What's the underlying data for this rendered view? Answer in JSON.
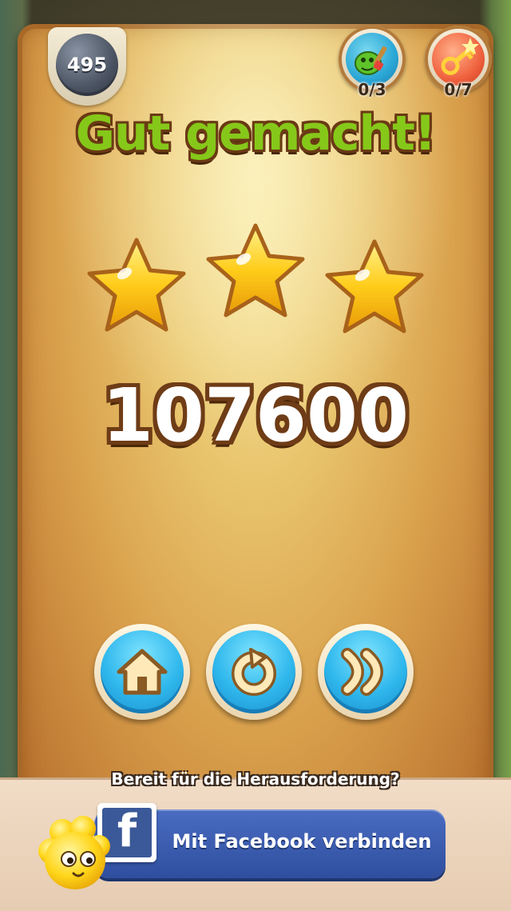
{
  "level": {
    "number": "495"
  },
  "counters": [
    {
      "icon": "jelly-paint-icon",
      "value": "0/3"
    },
    {
      "icon": "golden-key-icon",
      "value": "0/7"
    }
  ],
  "result": {
    "title": "Gut gemacht!",
    "stars_earned": 3,
    "stars_total": 3,
    "score": "107600"
  },
  "actions": {
    "home_icon": "home-icon",
    "retry_icon": "retry-icon",
    "next_icon": "next-icon"
  },
  "footer": {
    "prompt": "Bereit für die Herausforderung?",
    "facebook_button_label": "Mit Facebook verbinden",
    "facebook_logo": "f"
  },
  "colors": {
    "title_green": "#86c81a",
    "button_blue": "#2fb7ec",
    "facebook_blue": "#3b5998",
    "star_gold": "#ffcc1a"
  }
}
